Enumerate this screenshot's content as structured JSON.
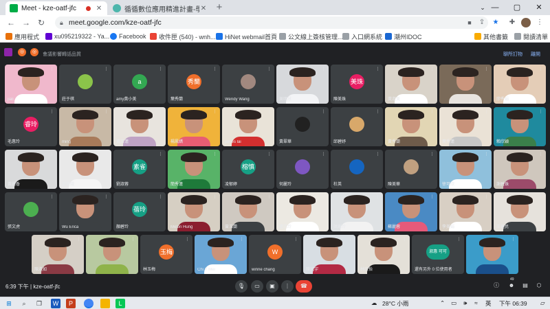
{
  "browser": {
    "tabs": [
      {
        "title": "Meet - kze-oatf-jfc",
        "active": true,
        "favicon_color": "#00ac47",
        "recording": true
      },
      {
        "title": "循循數位應用精進計畫-學習中心",
        "active": false,
        "favicon_color": "#5f6368",
        "recording": false
      }
    ],
    "new_tab": "+",
    "url": "meet.google.com/kze-oatf-jfc",
    "bookmarks": [
      {
        "label": "應用程式",
        "color": "#e8710a"
      },
      {
        "label": "xu095219322 - Ya...",
        "color": "#6001d2"
      },
      {
        "label": "Facebook",
        "color": "#1877f2"
      },
      {
        "label": "收件匣 (540) - wnh...",
        "color": "#ea4335"
      },
      {
        "label": "HiNet webmail首頁",
        "color": "#1a73e8"
      },
      {
        "label": "公文線上簽核管理...",
        "color": "#5f6368"
      },
      {
        "label": "入口網系統",
        "color": "#5f6368"
      },
      {
        "label": "潮州IDOC",
        "color": "#1967d2"
      },
      {
        "label": "其他書籤",
        "color": "#f9ab00"
      },
      {
        "label": "閱讀清單",
        "color": "#5f6368"
      }
    ]
  },
  "meet": {
    "banner": "會議影響轉話品質",
    "top_links": [
      "聊所訂物",
      "離開"
    ],
    "participants": [
      {
        "name": "jiali",
        "type": "video",
        "bg": "#f0b8cc",
        "shirt": "#ffffff"
      },
      {
        "name": "莊于棋",
        "type": "avatar",
        "initial": "",
        "color": "#8bc34a"
      },
      {
        "name": "amy黃小美",
        "type": "avatar",
        "initial": "a",
        "color": "#33a852"
      },
      {
        "name": "葉秀蘭",
        "type": "avatar",
        "initial": "秀蘭",
        "color": "#f06f2b"
      },
      {
        "name": "Wendy Wang",
        "type": "avatar",
        "initial": "",
        "color": "#a1887f"
      },
      {
        "name": "吳明慧",
        "type": "video",
        "bg": "#d7d9dc",
        "shirt": "#f3f4f6"
      },
      {
        "name": "陳美珠",
        "type": "avatar",
        "initial": "美珠",
        "color": "#e91e63"
      },
      {
        "name": "黃淑美",
        "type": "video",
        "bg": "#d9d3c9",
        "shirt": "#ffffff"
      },
      {
        "name": "",
        "type": "video",
        "bg": "#7a6a59",
        "shirt": "#e8e4df"
      },
      {
        "name": "廖秀娟",
        "type": "video",
        "bg": "#e4cdb7",
        "shirt": "#ffffff"
      },
      {
        "name": "毛惠玲",
        "type": "avatar",
        "initial": "睿玲",
        "color": "#e91e63"
      },
      {
        "name": "ming",
        "type": "video",
        "bg": "#c8b9a6",
        "shirt": "#a87a5a"
      },
      {
        "name": "黃玉蓮",
        "type": "video",
        "bg": "#e8e4de",
        "shirt": "#bfa3c4"
      },
      {
        "name": "楊鳳嬌",
        "type": "video",
        "bg": "#f0b33a",
        "shirt": "#e85d73"
      },
      {
        "name": "james lai",
        "type": "video",
        "bg": "#e9e3d8",
        "shirt": "#d32f2f"
      },
      {
        "name": "黃翠華",
        "type": "avatar",
        "initial": "",
        "color": "#212121"
      },
      {
        "name": "邱碧妤",
        "type": "avatar",
        "initial": "",
        "color": "#d8a86a"
      },
      {
        "name": "黃秀蘭",
        "type": "video",
        "bg": "#e2d6b4",
        "shirt": "#6e5b4a"
      },
      {
        "name": "葉秀蓮",
        "type": "video",
        "bg": "#eae2d6",
        "shirt": "#c7c7c7"
      },
      {
        "name": "賴欣穎",
        "type": "video",
        "bg": "#1f8a9e",
        "shirt": "#3a7f4a"
      },
      {
        "name": "黃麗香",
        "type": "video",
        "bg": "#d9dadb",
        "shirt": "#1a1a1a"
      },
      {
        "name": "邵美娥",
        "type": "video",
        "bg": "#e9e9e9",
        "shirt": "#f5f5f5"
      },
      {
        "name": "劉淑蓉",
        "type": "avatar",
        "initial": "素雀",
        "color": "#16a085"
      },
      {
        "name": "簡秀蓮",
        "type": "video",
        "bg": "#58b368",
        "shirt": "#1e7a3a"
      },
      {
        "name": "凌郁婷",
        "type": "avatar",
        "initial": "榕慎",
        "color": "#16a085"
      },
      {
        "name": "何麗玲",
        "type": "avatar",
        "initial": "",
        "color": "#7e57c2"
      },
      {
        "name": "杜英",
        "type": "avatar",
        "initial": "",
        "color": "#1565c0"
      },
      {
        "name": "陳美華",
        "type": "avatar",
        "initial": "",
        "color": "#c0a080"
      },
      {
        "name": "徐可欣",
        "type": "video",
        "bg": "#8fc0dc",
        "shirt": "#ffffff"
      },
      {
        "name": "謝碧珠",
        "type": "video",
        "bg": "#cfc7bd",
        "shirt": "#9c4b6a"
      },
      {
        "name": "張文虎",
        "type": "avatar",
        "initial": "",
        "color": "#4caf50"
      },
      {
        "name": "Wu Erica",
        "type": "video",
        "bg": "#3c4043",
        "shirt": "#3c4043"
      },
      {
        "name": "顏碧玲",
        "type": "avatar",
        "initial": "蓓玲",
        "color": "#16a085"
      },
      {
        "name": "Melon Hung",
        "type": "video",
        "bg": "#d6cfc3",
        "shirt": "#8b1e2f"
      },
      {
        "name": "曾玉蘭",
        "type": "video",
        "bg": "#cfc9c1",
        "shirt": "#3c4043"
      },
      {
        "name": "盧巧玲",
        "type": "video",
        "bg": "#ece9e2",
        "shirt": "#ffffff"
      },
      {
        "name": "洪家玲",
        "type": "video",
        "bg": "#dfe2e4",
        "shirt": "#f2f2f2"
      },
      {
        "name": "蘇麗蓉",
        "type": "video",
        "bg": "#4a8ac4",
        "shirt": "#e65a7a"
      },
      {
        "name": "李美娟",
        "type": "video",
        "bg": "#d8cfc4",
        "shirt": "#ffffff"
      },
      {
        "name": "王建民",
        "type": "video",
        "bg": "#e6e2dc",
        "shirt": "#3c4043"
      }
    ],
    "bottom_row": [
      {
        "name": "陳淑如",
        "type": "video",
        "bg": "#d5cfc6",
        "shirt": "#8a3a44"
      },
      {
        "name": "",
        "type": "video",
        "bg": "#b8c9a0",
        "shirt": "#8fb34a"
      },
      {
        "name": "林玉梅",
        "type": "avatar",
        "initial": "玉梅",
        "color": "#f06f2b"
      },
      {
        "name": "Chi Y Mei",
        "type": "video",
        "bg": "#6aa6d6",
        "shirt": "#ffffff"
      },
      {
        "name": "winne chang",
        "type": "avatar",
        "initial": "W",
        "color": "#f06f2b"
      },
      {
        "name": "陳冠宇",
        "type": "video",
        "bg": "#d8dee3",
        "shirt": "#b32a44"
      },
      {
        "name": "林欣怡",
        "type": "video",
        "bg": "#e4e0d8",
        "shirt": "#1a1a1a"
      },
      {
        "name": "還有另外 0 位使用者",
        "type": "more",
        "initial": "淑惠 可可",
        "color": "#16a085"
      },
      {
        "name": "",
        "type": "video",
        "bg": "#3b9cc9",
        "shirt": "#1a4f8a"
      }
    ],
    "footer": {
      "time": "6:39 下午",
      "meeting_code": "kze-oatf-jfc",
      "participant_count": "49"
    }
  },
  "taskbar": {
    "weather": "28°C 小雨",
    "clock": "下午 06:39"
  }
}
